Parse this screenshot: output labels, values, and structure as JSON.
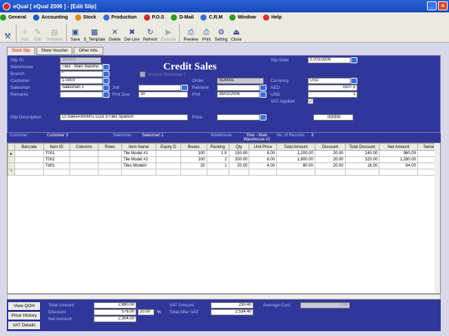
{
  "window": {
    "title": "eQual [ eQual 2006 ] - [Edit Slip]"
  },
  "menu": [
    "General",
    "Accounting",
    "Stock",
    "Production",
    "P.O.S",
    "D-Mail",
    "C.R.M",
    "Window",
    "Help"
  ],
  "toolbar": [
    {
      "label": "",
      "enabled": true,
      "icon": "tool-icon"
    },
    {
      "label": "Add",
      "enabled": false,
      "icon": "add-icon"
    },
    {
      "label": "Edit",
      "enabled": false,
      "icon": "edit-icon"
    },
    {
      "label": "Template",
      "enabled": false,
      "icon": "template-icon"
    },
    {
      "label": "Save",
      "enabled": true,
      "icon": "save-icon"
    },
    {
      "label": "S_Template",
      "enabled": true,
      "icon": "save-template-icon"
    },
    {
      "label": "Delete",
      "enabled": true,
      "icon": "delete-icon"
    },
    {
      "label": "Del-Line",
      "enabled": true,
      "icon": "delete-line-icon"
    },
    {
      "label": "Refresh",
      "enabled": true,
      "icon": "refresh-icon"
    },
    {
      "label": "Execute",
      "enabled": false,
      "icon": "execute-icon"
    },
    {
      "label": "Preview",
      "enabled": true,
      "icon": "preview-icon"
    },
    {
      "label": "Print",
      "enabled": true,
      "icon": "print-icon"
    },
    {
      "label": "Setting",
      "enabled": true,
      "icon": "setting-icon"
    },
    {
      "label": "Close",
      "enabled": true,
      "icon": "close-door-icon"
    }
  ],
  "tabs": [
    "Stock Slip",
    "Show Voucher",
    "Other Info."
  ],
  "form": {
    "heading": "Credit Sales",
    "slip_id_label": "Slip ID",
    "slip_id": "S00001",
    "warehouse_label": "Warehouse",
    "warehouse": "Tiles - Main Wareho",
    "branch_label": "Branch",
    "branch": "*",
    "customer_label": "Customer",
    "customer": "1-0003",
    "salesman_label": "Salesman",
    "salesman": "Salesman 1",
    "remarks_label": "Remarks",
    "remarks": "",
    "job_label": "Job",
    "job": "",
    "pmt_due_label": "Pmt Due",
    "pmt_due": "30",
    "invoice_received_label": "Invoice Received ?",
    "order_label": "Order",
    "order": "SO0001",
    "retrieve_label": "Retrieve",
    "retrieve": "",
    "pmt_label": "Pmt",
    "pmt": "06/02/2006",
    "slip_date_label": "Slip Date",
    "slip_date": "07/01/2006",
    "currency_label": "Currency",
    "currency": "USD",
    "aed_label": "AED",
    "aed": "1507.5",
    "usd_label": "USD",
    "usd": "1",
    "vat_applied_label": "VAT Applied",
    "vat_applied": "✓",
    "slip_desc_label": "Slip Description",
    "slip_desc": "Cr.Sales#S00001-Cust 3-Tiles Spanish",
    "price_label": "Price",
    "price": "",
    "barcode_btn": "|||||||||||||||"
  },
  "info": {
    "customer_label": "Customer",
    "customer": "Customer 3",
    "salesman_label": "Salesman",
    "salesman": "Salesman 1",
    "warehouse_label": "Warehouse",
    "warehouse": "Tiles - Main Warehouse #1",
    "records_label": "No. of Records",
    "records": "3"
  },
  "grid": {
    "columns": [
      "Barcode",
      "Item ID",
      "Columns",
      "Rows",
      "Item Name",
      "Expiry D",
      "Boxes",
      "Packing",
      "Qty",
      "Unit Price",
      "Total Amount",
      "Discount",
      "Total Discount",
      "Net Amount",
      "Serial"
    ],
    "rows": [
      [
        "",
        "T001",
        "",
        "",
        "Tile Model #1",
        "",
        "100",
        "1.5",
        "150.00",
        "8.00",
        "1,200.00",
        "20.00",
        "240.00",
        "960.00",
        ""
      ],
      [
        "",
        "T002",
        "",
        "",
        "Tile Model #2",
        "",
        "100",
        "2",
        "200.00",
        "8.00",
        "1,600.00",
        "20.00",
        "320.00",
        "1,280.00",
        ""
      ],
      [
        "",
        "Td01",
        "",
        "",
        "Tiles Model#",
        "",
        "20",
        "1",
        "20.00",
        "4.00",
        "80.00",
        "20.00",
        "16.00",
        "64.00",
        ""
      ]
    ]
  },
  "footer": {
    "view_qoh": "View QOH",
    "price_history": "Price History",
    "vat_details": "VAT Details",
    "total_amount_label": "Total Amount",
    "total_amount": "2,880.00",
    "discount_label": "Discount",
    "discount": "576.00",
    "discount_pct": "20.00",
    "pct_sign": "%",
    "net_amount_label": "Net Amount",
    "net_amount": "2,304.00",
    "vat_amount_label": "VAT Amount",
    "vat_amount": "230.40",
    "total_after_vat_label": "Total After VAT",
    "total_after_vat": "2,534.40",
    "average_cost_label": "Average Cost",
    "average_cost": "2.00"
  }
}
